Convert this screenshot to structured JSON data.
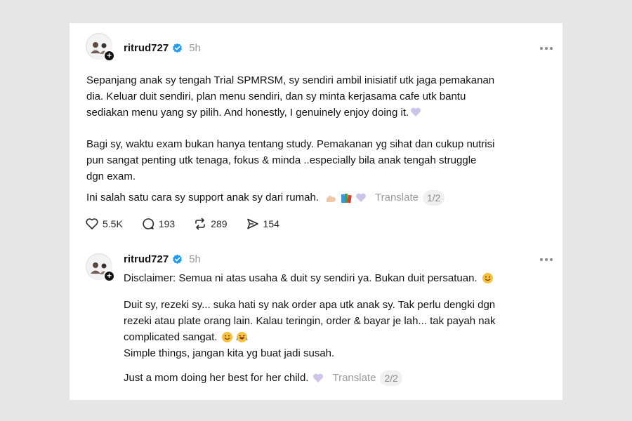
{
  "post1": {
    "username": "ritrud727",
    "time": "5h",
    "lines": [
      "Sepanjang anak sy tengah Trial SPMRSM, sy sendiri ambil inisiatif utk jaga pemakanan",
      "dia. Keluar duit sendiri, plan menu sendiri, dan sy minta kerjasama cafe utk bantu",
      "sediakan menu yang sy pilih. And honestly, I genuinely enjoy doing it.",
      "Bagi sy, waktu exam bukan hanya tentang study. Pemakanan yg sihat dan cukup nutrisi",
      "pun sangat penting utk tenaga, fokus & minda ..especially bila anak tengah struggle",
      "dgn exam.",
      "Ini salah satu cara sy support anak sy dari rumah."
    ],
    "translate": "Translate",
    "pager": "1/2",
    "likes": "5.5K",
    "comments": "193",
    "reposts": "289",
    "shares": "154"
  },
  "post2": {
    "username": "ritrud727",
    "time": "5h",
    "lines": [
      "Disclaimer: Semua ni atas usaha & duit sy sendiri ya. Bukan duit persatuan.",
      "Duit sy, rezeki sy... suka hati sy nak order apa utk anak sy. Tak perlu dengki dgn",
      "rezeki atau plate orang lain. Kalau teringin, order & bayar je lah... tak payah nak",
      "complicated sangat.",
      "Simple things, jangan kita yg buat jadi susah.",
      "Just a mom doing her best for her child."
    ],
    "translate": "Translate",
    "pager": "2/2"
  },
  "icons": {
    "verified": "verified-badge-icon",
    "more": "more-dots-icon",
    "like": "heart-icon",
    "comment": "comment-bubble-icon",
    "repost": "repost-icon",
    "share": "share-send-icon",
    "follow": "plus-icon"
  },
  "colors": {
    "verified": "#1d9bf0",
    "muted": "#9a9a9a",
    "background": "#e6e6e6"
  }
}
